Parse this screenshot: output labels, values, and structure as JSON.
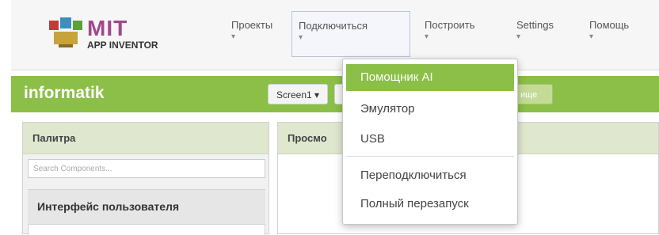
{
  "app": {
    "logo_title": "MIT",
    "logo_subtitle": "APP INVENTOR"
  },
  "topmenu": {
    "items": [
      {
        "label": "Проекты"
      },
      {
        "label": "Подключиться",
        "active": true
      },
      {
        "label": "Построить"
      },
      {
        "label": "Settings"
      },
      {
        "label": "Помощь"
      }
    ],
    "caret": "▾"
  },
  "project": {
    "name": "informatik",
    "screen_select": "Screen1 ▾",
    "partial_button": "ище"
  },
  "palette": {
    "title": "Палитра",
    "search_placeholder": "Search Components...",
    "category": "Интерфейс пользователя"
  },
  "viewer": {
    "title": "Просмо"
  },
  "connect_menu": {
    "items": [
      {
        "label": "Помощник AI",
        "highlighted": true
      },
      {
        "label": "Эмулятор"
      },
      {
        "label": "USB"
      },
      {
        "label": "Переподключиться"
      },
      {
        "label": "Полный перезапуск"
      }
    ]
  },
  "colors": {
    "accent_green": "#8bbf47",
    "logo_purple": "#a1488b"
  }
}
